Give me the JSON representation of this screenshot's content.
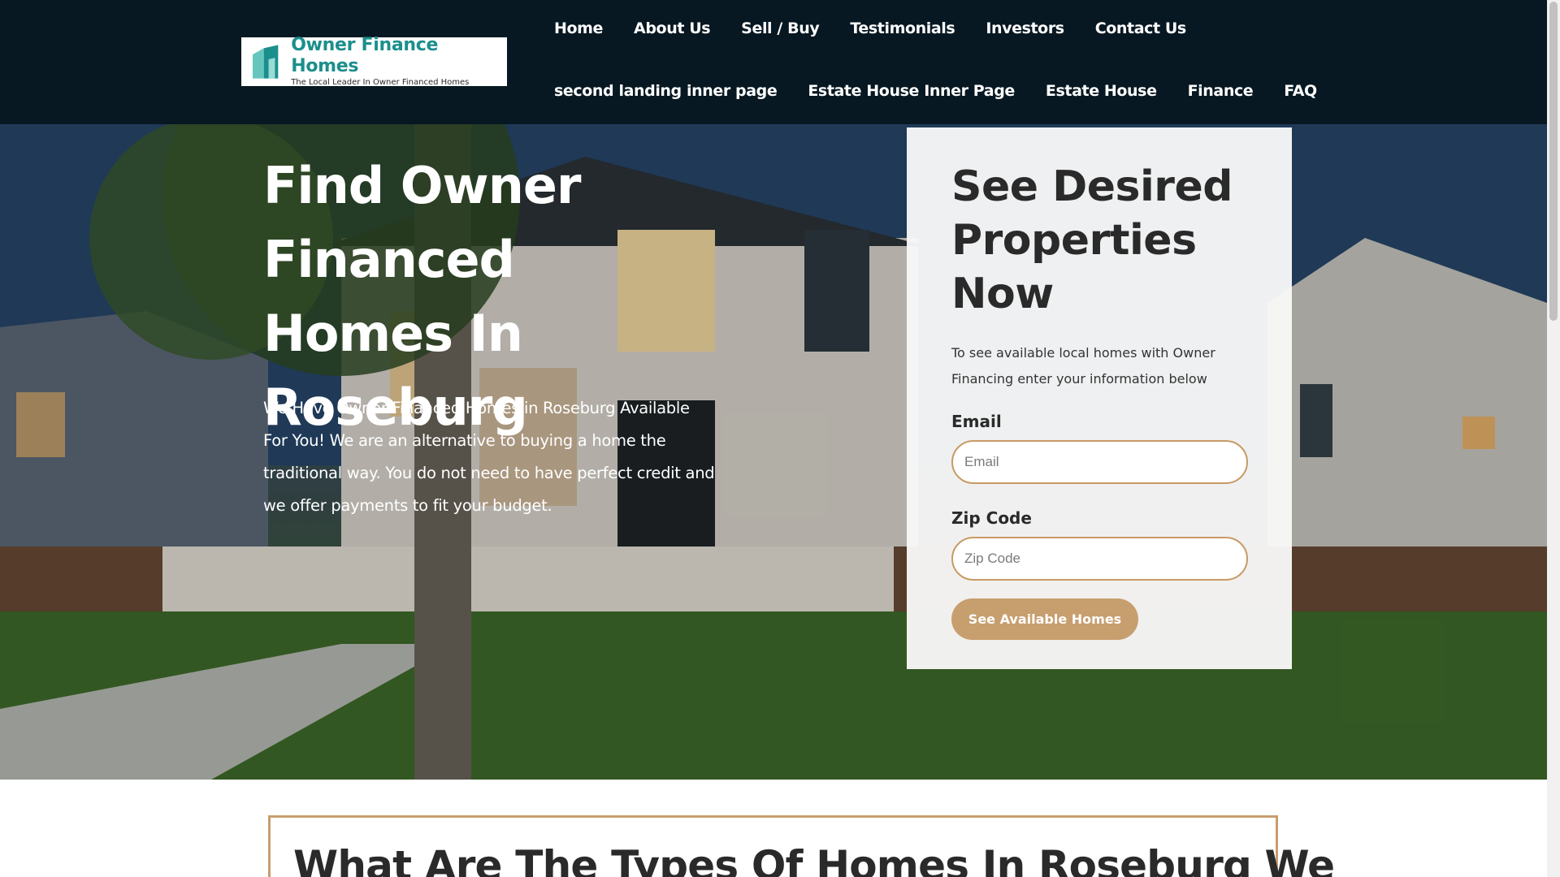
{
  "header": {
    "logo": {
      "title": "Owner Finance Homes",
      "tagline": "The Local Leader In Owner Financed Homes",
      "icon": "house-logo-icon",
      "brand_color": "#1b8f8c"
    },
    "nav_row1": [
      {
        "label": "Home"
      },
      {
        "label": "About Us"
      },
      {
        "label": "Sell / Buy"
      },
      {
        "label": "Testimonials"
      },
      {
        "label": "Investors"
      },
      {
        "label": "Contact Us"
      }
    ],
    "nav_row2": [
      {
        "label": "second landing inner page"
      },
      {
        "label": "Estate House Inner Page"
      },
      {
        "label": "Estate House"
      },
      {
        "label": "Finance"
      },
      {
        "label": "FAQ"
      }
    ],
    "background": "#071822"
  },
  "hero": {
    "title": "Find Owner Financed Homes In Roseburg",
    "text": "We Have Owner Financed Homes in Roseburg Available For You! We are an alternative to buying a home the traditional way. You do not need to have perfect credit and we offer payments to fit your budget.",
    "image": "house-at-dusk-photo"
  },
  "form": {
    "title": "See Desired Properties Now",
    "description": "To see available local homes with Owner Financing enter your information below",
    "email_label": "Email",
    "email_placeholder": "Email",
    "zip_label": "Zip Code",
    "zip_placeholder": "Zip Code",
    "submit_label": "See Available Homes",
    "accent_color": "#c79e6e"
  },
  "section": {
    "title": "What Are The Types Of Homes In Roseburg We"
  }
}
